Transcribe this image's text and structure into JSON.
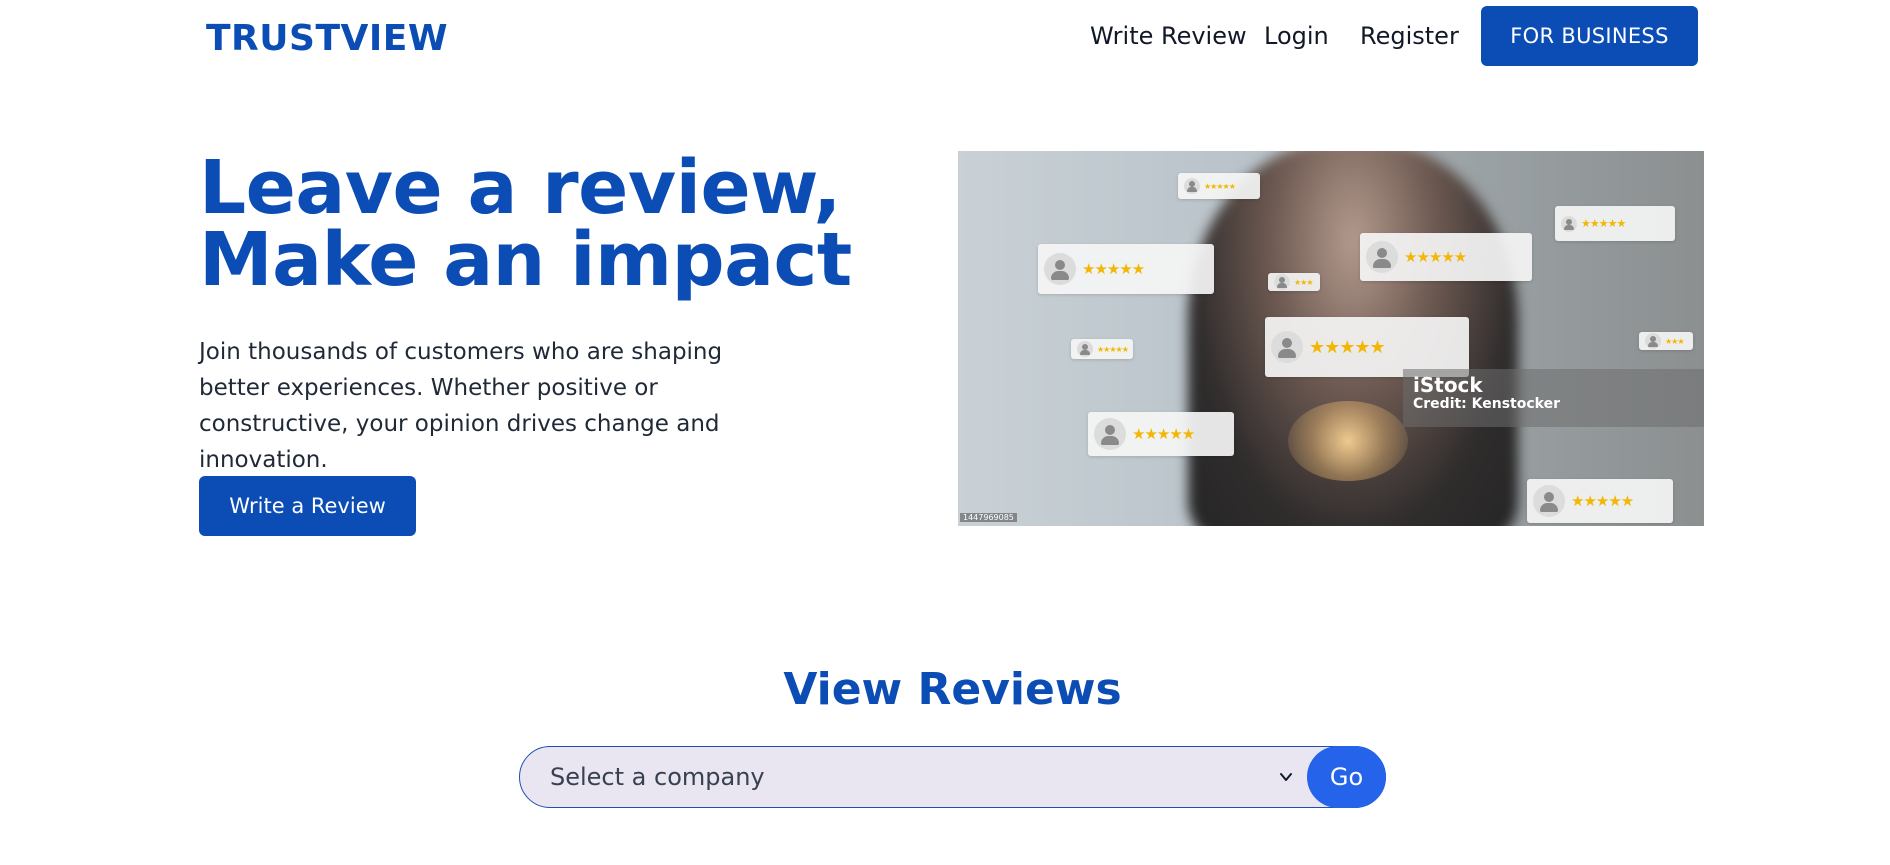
{
  "header": {
    "logo": "TRUSTVIEW",
    "nav": {
      "write_review": "Write Review",
      "login": "Login",
      "register": "Register"
    },
    "business_button": "FOR BUSINESS"
  },
  "hero": {
    "title_line1": "Leave a review,",
    "title_line2": "Make an impact",
    "description": "Join thousands of customers who are shaping better experiences. Whether positive or constructive, your opinion drives change and innovation.",
    "cta_label": "Write a Review",
    "image": {
      "watermark_brand": "iStock",
      "watermark_credit": "Credit: Kenstocker",
      "image_id": "1447969085"
    }
  },
  "reviews_section": {
    "title": "View Reviews",
    "select_value": "Select a company",
    "go_label": "Go"
  },
  "colors": {
    "brand": "#0b4db5",
    "go_button": "#2563eb",
    "select_bg": "#e9e5f1",
    "stars": "#f2b705"
  }
}
